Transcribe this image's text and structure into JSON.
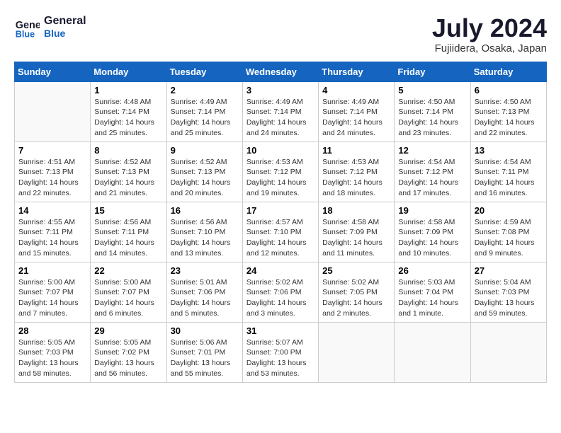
{
  "header": {
    "logo_line1": "General",
    "logo_line2": "Blue",
    "month": "July 2024",
    "location": "Fujiidera, Osaka, Japan"
  },
  "weekdays": [
    "Sunday",
    "Monday",
    "Tuesday",
    "Wednesday",
    "Thursday",
    "Friday",
    "Saturday"
  ],
  "weeks": [
    [
      {
        "day": "",
        "info": ""
      },
      {
        "day": "1",
        "info": "Sunrise: 4:48 AM\nSunset: 7:14 PM\nDaylight: 14 hours\nand 25 minutes."
      },
      {
        "day": "2",
        "info": "Sunrise: 4:49 AM\nSunset: 7:14 PM\nDaylight: 14 hours\nand 25 minutes."
      },
      {
        "day": "3",
        "info": "Sunrise: 4:49 AM\nSunset: 7:14 PM\nDaylight: 14 hours\nand 24 minutes."
      },
      {
        "day": "4",
        "info": "Sunrise: 4:49 AM\nSunset: 7:14 PM\nDaylight: 14 hours\nand 24 minutes."
      },
      {
        "day": "5",
        "info": "Sunrise: 4:50 AM\nSunset: 7:14 PM\nDaylight: 14 hours\nand 23 minutes."
      },
      {
        "day": "6",
        "info": "Sunrise: 4:50 AM\nSunset: 7:13 PM\nDaylight: 14 hours\nand 22 minutes."
      }
    ],
    [
      {
        "day": "7",
        "info": "Sunrise: 4:51 AM\nSunset: 7:13 PM\nDaylight: 14 hours\nand 22 minutes."
      },
      {
        "day": "8",
        "info": "Sunrise: 4:52 AM\nSunset: 7:13 PM\nDaylight: 14 hours\nand 21 minutes."
      },
      {
        "day": "9",
        "info": "Sunrise: 4:52 AM\nSunset: 7:13 PM\nDaylight: 14 hours\nand 20 minutes."
      },
      {
        "day": "10",
        "info": "Sunrise: 4:53 AM\nSunset: 7:12 PM\nDaylight: 14 hours\nand 19 minutes."
      },
      {
        "day": "11",
        "info": "Sunrise: 4:53 AM\nSunset: 7:12 PM\nDaylight: 14 hours\nand 18 minutes."
      },
      {
        "day": "12",
        "info": "Sunrise: 4:54 AM\nSunset: 7:12 PM\nDaylight: 14 hours\nand 17 minutes."
      },
      {
        "day": "13",
        "info": "Sunrise: 4:54 AM\nSunset: 7:11 PM\nDaylight: 14 hours\nand 16 minutes."
      }
    ],
    [
      {
        "day": "14",
        "info": "Sunrise: 4:55 AM\nSunset: 7:11 PM\nDaylight: 14 hours\nand 15 minutes."
      },
      {
        "day": "15",
        "info": "Sunrise: 4:56 AM\nSunset: 7:11 PM\nDaylight: 14 hours\nand 14 minutes."
      },
      {
        "day": "16",
        "info": "Sunrise: 4:56 AM\nSunset: 7:10 PM\nDaylight: 14 hours\nand 13 minutes."
      },
      {
        "day": "17",
        "info": "Sunrise: 4:57 AM\nSunset: 7:10 PM\nDaylight: 14 hours\nand 12 minutes."
      },
      {
        "day": "18",
        "info": "Sunrise: 4:58 AM\nSunset: 7:09 PM\nDaylight: 14 hours\nand 11 minutes."
      },
      {
        "day": "19",
        "info": "Sunrise: 4:58 AM\nSunset: 7:09 PM\nDaylight: 14 hours\nand 10 minutes."
      },
      {
        "day": "20",
        "info": "Sunrise: 4:59 AM\nSunset: 7:08 PM\nDaylight: 14 hours\nand 9 minutes."
      }
    ],
    [
      {
        "day": "21",
        "info": "Sunrise: 5:00 AM\nSunset: 7:07 PM\nDaylight: 14 hours\nand 7 minutes."
      },
      {
        "day": "22",
        "info": "Sunrise: 5:00 AM\nSunset: 7:07 PM\nDaylight: 14 hours\nand 6 minutes."
      },
      {
        "day": "23",
        "info": "Sunrise: 5:01 AM\nSunset: 7:06 PM\nDaylight: 14 hours\nand 5 minutes."
      },
      {
        "day": "24",
        "info": "Sunrise: 5:02 AM\nSunset: 7:06 PM\nDaylight: 14 hours\nand 3 minutes."
      },
      {
        "day": "25",
        "info": "Sunrise: 5:02 AM\nSunset: 7:05 PM\nDaylight: 14 hours\nand 2 minutes."
      },
      {
        "day": "26",
        "info": "Sunrise: 5:03 AM\nSunset: 7:04 PM\nDaylight: 14 hours\nand 1 minute."
      },
      {
        "day": "27",
        "info": "Sunrise: 5:04 AM\nSunset: 7:03 PM\nDaylight: 13 hours\nand 59 minutes."
      }
    ],
    [
      {
        "day": "28",
        "info": "Sunrise: 5:05 AM\nSunset: 7:03 PM\nDaylight: 13 hours\nand 58 minutes."
      },
      {
        "day": "29",
        "info": "Sunrise: 5:05 AM\nSunset: 7:02 PM\nDaylight: 13 hours\nand 56 minutes."
      },
      {
        "day": "30",
        "info": "Sunrise: 5:06 AM\nSunset: 7:01 PM\nDaylight: 13 hours\nand 55 minutes."
      },
      {
        "day": "31",
        "info": "Sunrise: 5:07 AM\nSunset: 7:00 PM\nDaylight: 13 hours\nand 53 minutes."
      },
      {
        "day": "",
        "info": ""
      },
      {
        "day": "",
        "info": ""
      },
      {
        "day": "",
        "info": ""
      }
    ]
  ]
}
